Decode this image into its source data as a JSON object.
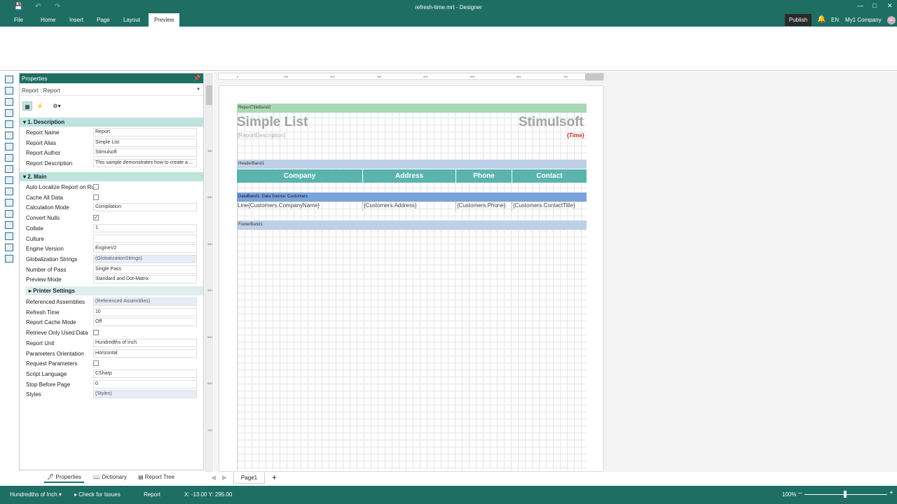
{
  "titlebar": {
    "title": "refresh-time.mrt - Designer",
    "menus": [
      "File",
      "Home",
      "Insert",
      "Page",
      "Layout",
      "Preview"
    ],
    "active_menu": "Preview",
    "publish": "Publish",
    "lang": "EN",
    "company": "My1 Company",
    "avatar": "MC"
  },
  "properties": {
    "header": "Properties",
    "selector": "Report : Report",
    "categories": {
      "description": "1. Description",
      "main": "2. Main",
      "printer_settings": "Printer Settings"
    },
    "description_rows": [
      {
        "name": "Report Name",
        "value": "Report"
      },
      {
        "name": "Report Alias",
        "value": "Simple List"
      },
      {
        "name": "Report Author",
        "value": "Stimulsoft"
      },
      {
        "name": "Report Description",
        "value": "This sample demonstrates how to create a ..."
      }
    ],
    "main_rows": [
      {
        "name": "Auto Localize Report on Ru",
        "value": "",
        "checked": false
      },
      {
        "name": "Cache All Data",
        "value": "",
        "checked": false
      },
      {
        "name": "Calculation Mode",
        "value": "Compilation"
      },
      {
        "name": "Convert Nulls",
        "value": "",
        "checked": true
      },
      {
        "name": "Collate",
        "value": "1"
      },
      {
        "name": "Culture",
        "value": ""
      },
      {
        "name": "Engine Version",
        "value": "EngineV2"
      },
      {
        "name": "Globalization Strings",
        "value": "(GlobalizationStrings)"
      },
      {
        "name": "Number of Pass",
        "value": "Single Pass"
      },
      {
        "name": "Preview Mode",
        "value": "Standard and Dot-Matrix"
      }
    ],
    "main_rows2": [
      {
        "name": "Referenced Assemblies",
        "value": "(Referenced Assemblies)"
      },
      {
        "name": "Refresh Time",
        "value": "10"
      },
      {
        "name": "Report Cache Mode",
        "value": "Off"
      },
      {
        "name": "Retrieve Only Used Data",
        "value": "",
        "checked": false
      },
      {
        "name": "Report Unit",
        "value": "Hundredths of Inch"
      },
      {
        "name": "Parameters Orientation",
        "value": "Horizontal"
      },
      {
        "name": "Request Parameters",
        "value": "",
        "checked": false
      },
      {
        "name": "Script Language",
        "value": "CSharp"
      },
      {
        "name": "Stop Before Page",
        "value": "0"
      },
      {
        "name": "Styles",
        "value": "(Styles)"
      }
    ],
    "tabs": [
      "Properties",
      "Dictionary",
      "Report Tree"
    ]
  },
  "ruler": {
    "h": [
      "0",
      "100",
      "200",
      "300",
      "400",
      "500",
      "600",
      "700"
    ],
    "v": [
      "0",
      "100",
      "200",
      "300",
      "400",
      "500",
      "600",
      "700"
    ]
  },
  "report": {
    "band_title": "ReportTitleBand2",
    "title": "Simple List",
    "brand": "Stimulsoft",
    "description": "{ReportDescription}",
    "time": "{Time}",
    "band_header": "HeaderBand1",
    "columns": [
      "Company",
      "Address",
      "Phone",
      "Contact"
    ],
    "band_data": "DataBand1; Data Source: Customers",
    "data_cells": [
      "Line{Customers.CompanyName}",
      "{Customers.Address}",
      "{Customers.Phone}",
      "{Customers.ContactTitle}"
    ],
    "band_footer": "FooterBand1"
  },
  "page_tab": "Page1",
  "status": {
    "unit": "Hundredths of Inch",
    "check": "Check for Issues",
    "report": "Report",
    "coords": "X: -13.00 Y: 295.00",
    "zoom": "100%",
    "zoom_value": 1.0
  }
}
